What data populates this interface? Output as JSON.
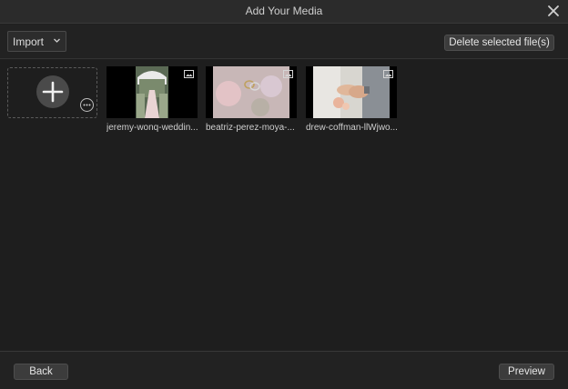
{
  "window": {
    "title": "Add Your Media"
  },
  "toolbar": {
    "import_label": "Import",
    "delete_label": "Delete selected file(s)"
  },
  "media": [
    {
      "label": "jeremy-wonq-weddin..."
    },
    {
      "label": "beatriz-perez-moya-..."
    },
    {
      "label": "drew-coffman-llWjwo..."
    }
  ],
  "footer": {
    "back_label": "Back",
    "preview_label": "Preview"
  },
  "colors": {
    "background": "#1f1f1f",
    "button": "#3c3c3c",
    "titlebar": "#2b2b2b"
  }
}
